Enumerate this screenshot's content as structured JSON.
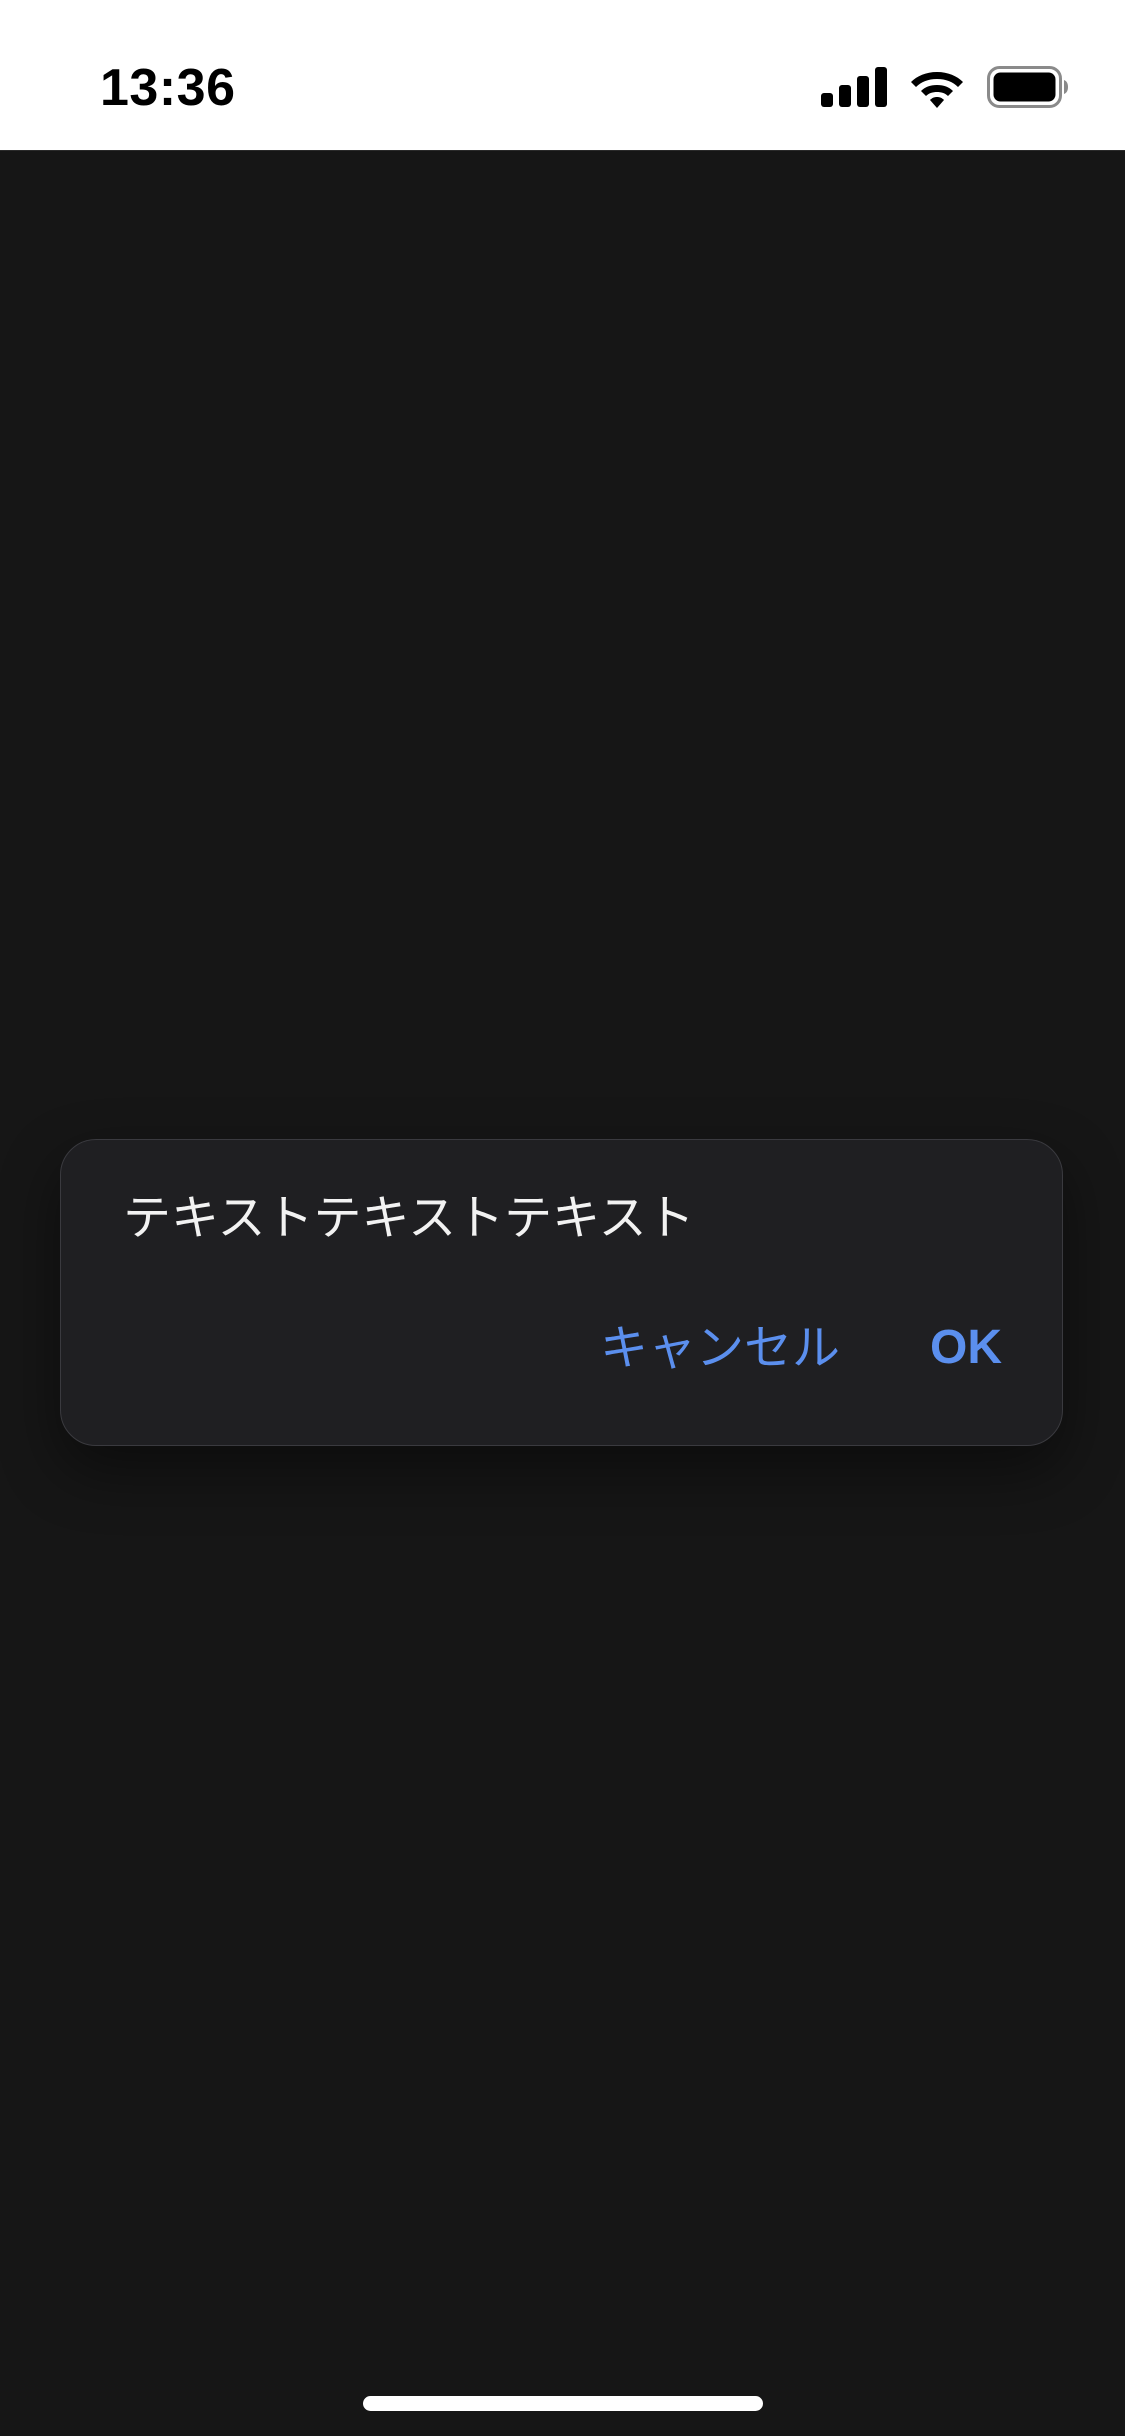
{
  "status_bar": {
    "time": "13:36",
    "icons": [
      "signal-icon",
      "wifi-icon",
      "battery-icon"
    ],
    "background_color": "#ffffff",
    "text_color": "#000000"
  },
  "screen": {
    "background_color": "#161616"
  },
  "dialog": {
    "message": "テキストテキストテキスト",
    "cancel_label": "キャンセル",
    "ok_label": "OK",
    "background_color": "#1f1f22",
    "accent_color": "#5b8fee"
  }
}
